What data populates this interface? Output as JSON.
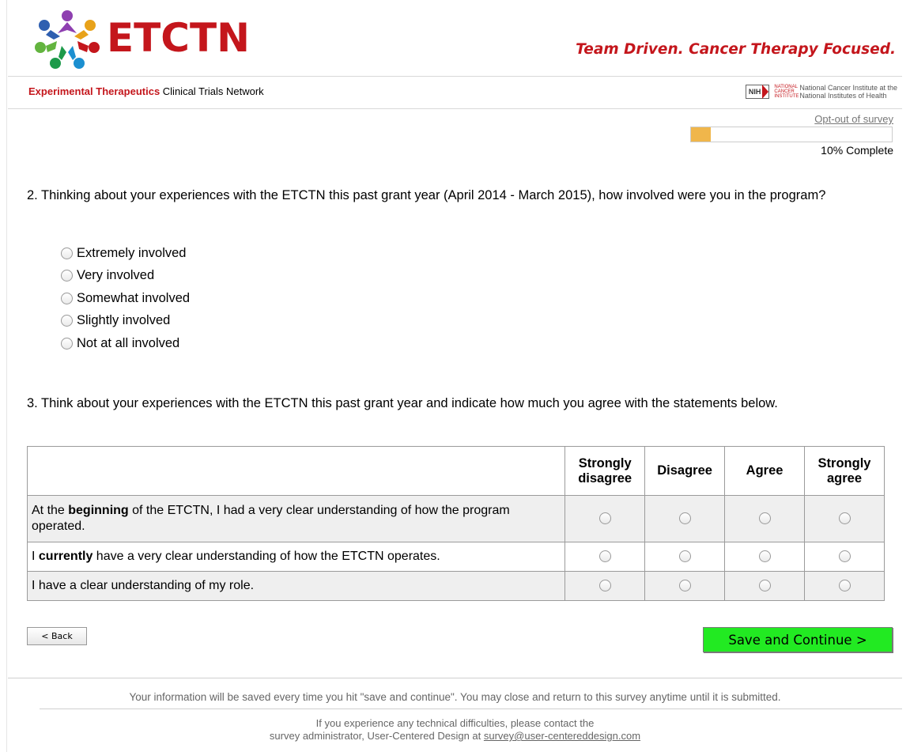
{
  "header": {
    "logo_text": "ETCTN",
    "tagline": "Team Driven. Cancer Therapy Focused.",
    "subtitle_red": "Experimental Therapeutics",
    "subtitle_rest": " Clinical Trials Network",
    "nih_badge": "NIH",
    "nci_small": "NATIONAL CANCER INSTITUTE",
    "nci_line1": "National Cancer Institute at the",
    "nci_line2": "National Institutes of Health"
  },
  "survey": {
    "optout_label": "Opt-out of survey",
    "progress_fraction": 0.1,
    "progress_text": "10% Complete"
  },
  "q2": {
    "text": "2. Thinking about your experiences with the ETCTN this past grant year (April 2014 - March 2015), how involved were you in the program?",
    "options": [
      "Extremely involved",
      "Very involved",
      "Somewhat involved",
      "Slightly involved",
      "Not at all involved"
    ]
  },
  "q3": {
    "text": "3. Think about your experiences with the ETCTN this past grant year and indicate how much you agree with the statements below.",
    "columns": [
      "Strongly disagree",
      "Disagree",
      "Agree",
      "Strongly agree"
    ],
    "rows": [
      {
        "pre": "At the ",
        "bold": "beginning",
        "post": " of the ETCTN, I had a very clear understanding of how the program operated."
      },
      {
        "pre": "I ",
        "bold": "currently",
        "post": " have a very clear understanding of how the ETCTN operates."
      },
      {
        "pre": "I have a clear understanding of my role.",
        "bold": "",
        "post": ""
      }
    ]
  },
  "buttons": {
    "back": "< Back",
    "save": "Save and Continue >",
    "save_color": "#22ea22"
  },
  "footer": {
    "note": "Your information will be saved every time you hit \"save and continue\". You may close and return to this survey anytime until it is submitted.",
    "contact_line1": "If you experience any technical difficulties, please contact the",
    "contact_line2_prefix": "survey administrator, User-Centered Design at ",
    "contact_email": "survey@user-centereddesign.com"
  },
  "colors": {
    "brand_red": "#c4161c",
    "progress_orange": "#f0b64b"
  }
}
